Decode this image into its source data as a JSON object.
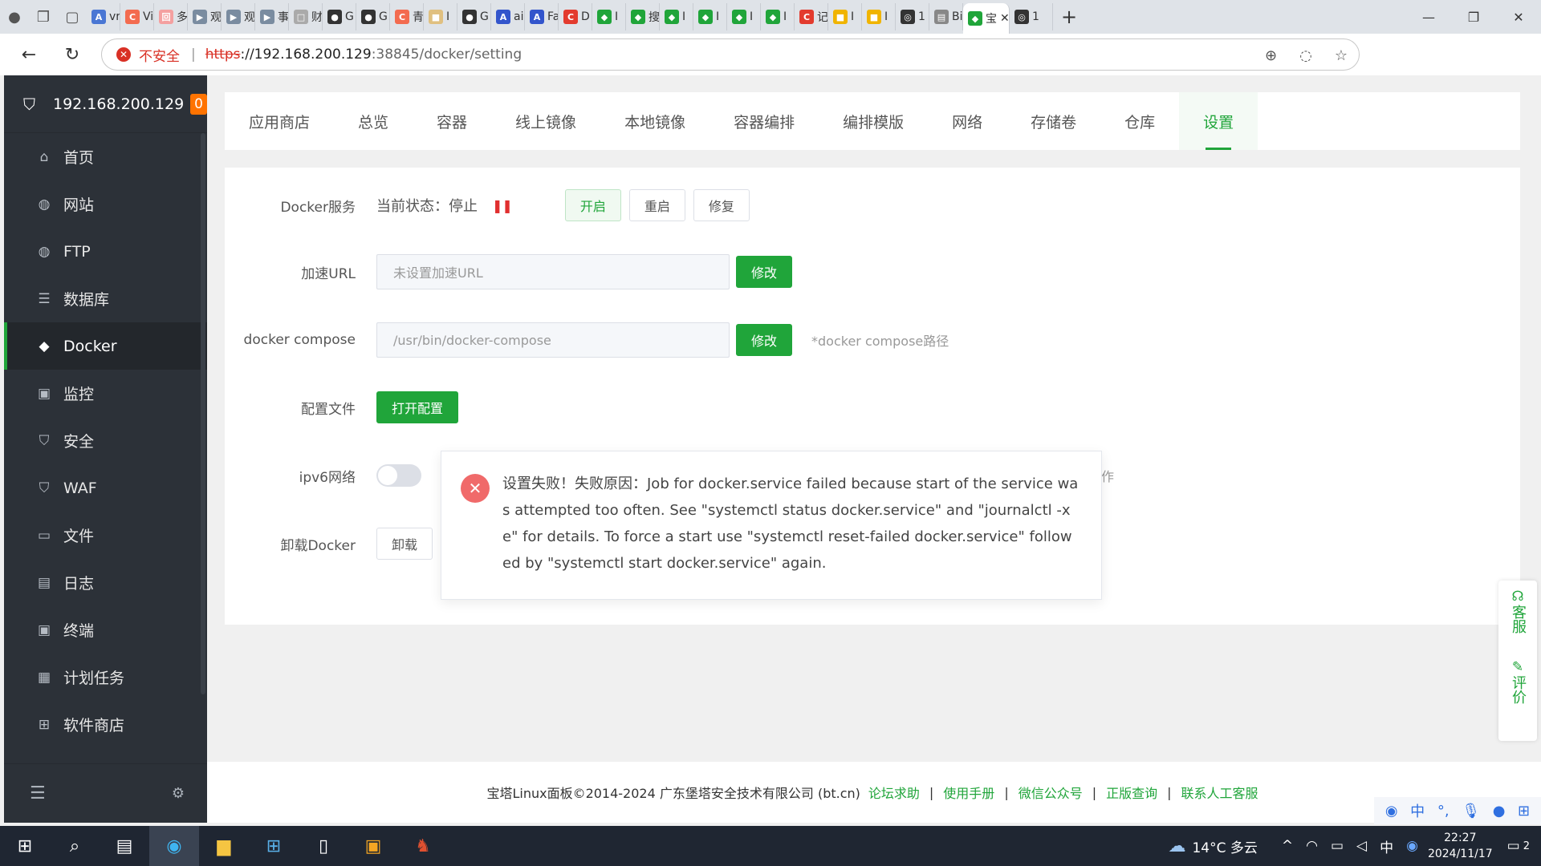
{
  "browser": {
    "tabs": [
      {
        "label": "vr",
        "fav_color": "#4a77d4",
        "fav": "A"
      },
      {
        "label": "Vi",
        "fav_color": "#f36b4f",
        "fav": "C"
      },
      {
        "label": "多",
        "fav_color": "#f4a0a0",
        "fav": "回"
      },
      {
        "label": "观",
        "fav_color": "#7a8ca0",
        "fav": "▶"
      },
      {
        "label": "观",
        "fav_color": "#7a8ca0",
        "fav": "▶"
      },
      {
        "label": "事",
        "fav_color": "#7a8ca0",
        "fav": "▶"
      },
      {
        "label": "财",
        "fav_color": "#aaaaaa",
        "fav": "□"
      },
      {
        "label": "G",
        "fav_color": "#333333",
        "fav": "●"
      },
      {
        "label": "G",
        "fav_color": "#333333",
        "fav": "●"
      },
      {
        "label": "青",
        "fav_color": "#f36b4f",
        "fav": "C"
      },
      {
        "label": "I",
        "fav_color": "#e0c080",
        "fav": "■"
      },
      {
        "label": "G",
        "fav_color": "#333333",
        "fav": "●"
      },
      {
        "label": "ai",
        "fav_color": "#3355cc",
        "fav": "A"
      },
      {
        "label": "Fa",
        "fav_color": "#3355cc",
        "fav": "A"
      },
      {
        "label": "D",
        "fav_color": "#e33b2e",
        "fav": "C"
      },
      {
        "label": "I",
        "fav_color": "#20a53a",
        "fav": "◆"
      },
      {
        "label": "搜",
        "fav_color": "#20a53a",
        "fav": "◆"
      },
      {
        "label": "I",
        "fav_color": "#20a53a",
        "fav": "◆"
      },
      {
        "label": "I",
        "fav_color": "#20a53a",
        "fav": "◆"
      },
      {
        "label": "I",
        "fav_color": "#20a53a",
        "fav": "◆"
      },
      {
        "label": "I",
        "fav_color": "#20a53a",
        "fav": "◆"
      },
      {
        "label": "记",
        "fav_color": "#e33b2e",
        "fav": "C"
      },
      {
        "label": "I",
        "fav_color": "#f0b400",
        "fav": "■"
      },
      {
        "label": "I",
        "fav_color": "#f0b400",
        "fav": "■"
      },
      {
        "label": "1",
        "fav_color": "#333333",
        "fav": "◎"
      },
      {
        "label": "Bi",
        "fav_color": "#888888",
        "fav": "▤"
      }
    ],
    "active_tab_label": "宝",
    "url_security": "不安全",
    "url_scheme": "https",
    "url_host": "://192.168.200.129",
    "url_rest": ":38845/docker/setting"
  },
  "sidebar": {
    "server_name": "192.168.200.129",
    "badge": "0",
    "items": [
      {
        "label": "首页",
        "icon": "home-icon",
        "glyph": "⌂"
      },
      {
        "label": "网站",
        "icon": "globe-icon",
        "glyph": "◍"
      },
      {
        "label": "FTP",
        "icon": "ftp-globe-icon",
        "glyph": "◍"
      },
      {
        "label": "数据库",
        "icon": "database-icon",
        "glyph": "☰"
      },
      {
        "label": "Docker",
        "icon": "docker-icon",
        "glyph": "◆"
      },
      {
        "label": "监控",
        "icon": "monitor-icon",
        "glyph": "▣"
      },
      {
        "label": "安全",
        "icon": "shield-icon",
        "glyph": "⛉"
      },
      {
        "label": "WAF",
        "icon": "waf-shield-icon",
        "glyph": "⛉"
      },
      {
        "label": "文件",
        "icon": "folder-icon",
        "glyph": "▭"
      },
      {
        "label": "日志",
        "icon": "log-icon",
        "glyph": "▤"
      },
      {
        "label": "终端",
        "icon": "terminal-icon",
        "glyph": "▣"
      },
      {
        "label": "计划任务",
        "icon": "calendar-icon",
        "glyph": "▦"
      },
      {
        "label": "软件商店",
        "icon": "apps-icon",
        "glyph": "⊞"
      }
    ]
  },
  "docker_tabs": [
    "应用商店",
    "总览",
    "容器",
    "线上镜像",
    "本地镜像",
    "容器编排",
    "编排模版",
    "网络",
    "存储卷",
    "仓库",
    "设置"
  ],
  "settings": {
    "service": {
      "label": "Docker服务",
      "status": "当前状态：停止",
      "start": "开启",
      "restart": "重启",
      "repair": "修复"
    },
    "mirror": {
      "label": "加速URL",
      "placeholder": "未设置加速URL",
      "button": "修改"
    },
    "compose": {
      "label": "docker compose",
      "placeholder": "/usr/bin/docker-compose",
      "button": "修改",
      "hint": "*docker compose路径"
    },
    "config": {
      "label": "配置文件",
      "button": "打开配置"
    },
    "ipv6": {
      "label": "ipv6网络",
      "enabled": false,
      "trailing": "作"
    },
    "uninstall": {
      "label": "卸载Docker",
      "button": "卸载"
    }
  },
  "toast": {
    "message": "设置失败！失败原因：Job for docker.service failed because start of the service was attempted too often. See \"systemctl status docker.service\" and \"journalctl -xe\" for details. To force a start use \"systemctl reset-failed docker.service\" followed by \"systemctl start docker.service\" again."
  },
  "footer": {
    "copyright": "宝塔Linux面板©2014-2024 广东堡塔安全技术有限公司 (bt.cn)",
    "links": [
      "论坛求助",
      "使用手册",
      "微信公众号",
      "正版查询",
      "联系人工客服"
    ]
  },
  "float_side": {
    "service": "客服",
    "review": "评价"
  },
  "ime": {
    "lang": "中"
  },
  "taskbar": {
    "weather": "14°C 多云",
    "input_lang": "中",
    "time": "22:27",
    "date": "2024/11/17",
    "notifications": "2"
  },
  "colors": {
    "accent": "#20a53a",
    "error": "#f06a6a",
    "sidebar_bg": "#2c3138"
  }
}
